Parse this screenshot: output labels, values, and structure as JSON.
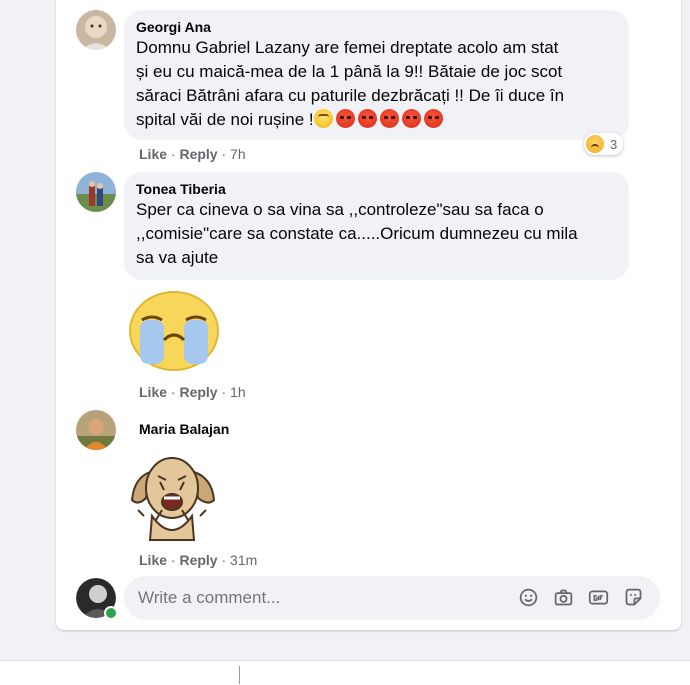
{
  "comments": [
    {
      "author": "Georgi Ana",
      "lines": [
        "Domnu Gabriel Lazany are femei dreptate acolo am stat",
        "și eu cu maică-mea de la 1 până la 9!! Bătaie de joc scot",
        "săraci Bătrâni afara cu paturile dezbrăcați !! De îi duce în",
        "spital văi de noi rușine !"
      ],
      "inline_emojis": [
        "eye-roll",
        "angry",
        "angry",
        "angry",
        "angry",
        "angry"
      ],
      "like": "Like",
      "reply": "Reply",
      "time": "7h",
      "reaction_icon": "sad-reaction-icon",
      "reaction_count": "3"
    },
    {
      "author": "Tonea Tiberia",
      "lines": [
        "Sper ca cineva o sa vina sa ,,controleze\"sau sa faca o",
        ",,comisie\"care sa constate ca.....Oricum dumnezeu cu mila",
        "sa va ajute"
      ],
      "sticker": "crying-face-sticker",
      "like": "Like",
      "reply": "Reply",
      "time": "1h"
    },
    {
      "author": "Maria Balajan",
      "sticker": "crying-dog-sticker",
      "like": "Like",
      "reply": "Reply",
      "time": "31m"
    }
  ],
  "separator": "·",
  "composer": {
    "placeholder": "Write a comment...",
    "icons": [
      "emoji-icon",
      "camera-icon",
      "gif-icon",
      "sticker-icon"
    ]
  },
  "colors": {
    "bubble": "#f0f2f5",
    "meta_text": "#65676b",
    "online": "#31a24c"
  }
}
